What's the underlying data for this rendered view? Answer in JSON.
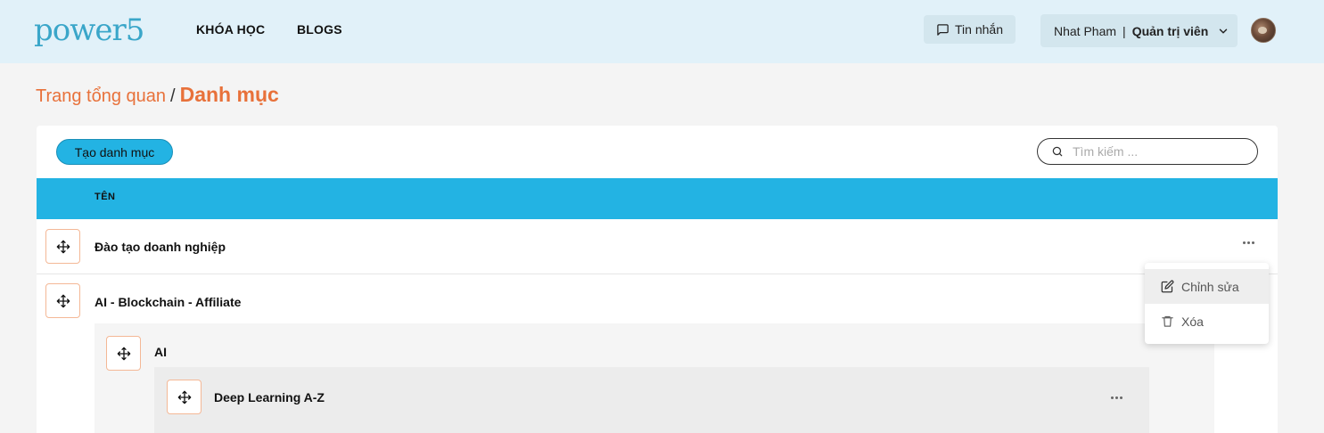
{
  "brand": {
    "name": "power5",
    "accent": "#e8713a",
    "primary": "#23b3e3"
  },
  "nav": {
    "courses": "KHÓA HỌC",
    "blogs": "BLOGS"
  },
  "header": {
    "messages_label": "Tin nhắn",
    "user_name": "Nhat Pham",
    "separator": "|",
    "user_role": "Quản trị viên"
  },
  "breadcrumb": {
    "home": "Trang tổng quan",
    "separator": "/",
    "current": "Danh mục"
  },
  "toolbar": {
    "create_label": "Tạo danh mục",
    "search_placeholder": "Tìm kiếm ..."
  },
  "table": {
    "column_name": "TÊN",
    "rows": [
      {
        "label": "Đào tạo doanh nghiệp"
      },
      {
        "label": "AI - Blockchain - Affiliate"
      },
      {
        "label": "AI"
      },
      {
        "label": "Deep Learning A-Z"
      }
    ]
  },
  "menu": {
    "edit": "Chỉnh sửa",
    "delete": "Xóa"
  },
  "icons": [
    "logo-mark-icon",
    "chat-icon",
    "chevron-down-icon",
    "search-icon",
    "move-icon",
    "more-horizontal-icon",
    "edit-icon",
    "trash-icon"
  ]
}
